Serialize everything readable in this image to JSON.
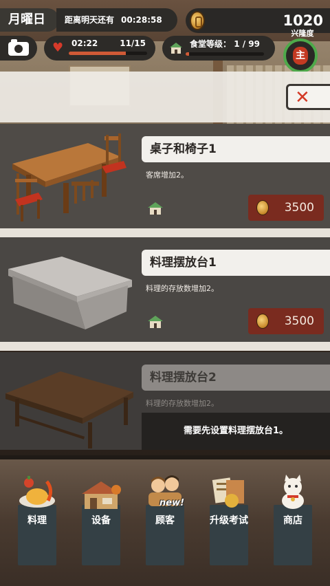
{
  "hud": {
    "weekday": "月曜日",
    "countdown_label": "距离明天还有",
    "countdown_time": "00:28:58",
    "coins": "1020",
    "stamina_time": "02:22",
    "stamina_count": "11/15",
    "stamina_fraction": 0.73,
    "level_label": "食堂等级：",
    "level_value": "1 / 99",
    "level_fraction": 0.01,
    "prosperity_label": "兴隆度",
    "prosperity_glyph": "主"
  },
  "shop": {
    "items": [
      {
        "name": "桌子和椅子1",
        "desc": "客席增加2。",
        "price": "3500",
        "locked": false
      },
      {
        "name": "料理摆放台1",
        "desc": "料理的存放数增加2。",
        "price": "3500",
        "locked": false
      },
      {
        "name": "料理摆放台2",
        "desc": "料理的存放数增加2。",
        "locked_msg": "需要先设置料理摆放台1。",
        "locked": true
      }
    ]
  },
  "nav": {
    "items": [
      {
        "label": "料理",
        "icon": "cooking-icon"
      },
      {
        "label": "设备",
        "icon": "equipment-icon"
      },
      {
        "label": "顾客",
        "icon": "customers-icon"
      },
      {
        "label": "升级考试",
        "icon": "exam-icon"
      },
      {
        "label": "商店",
        "icon": "shop-icon"
      }
    ],
    "new_badge": "new!"
  },
  "colors": {
    "accent_red": "#7a2b1f",
    "progress_fill": "#d05a36",
    "prosperity_ring": "#4ea94a"
  }
}
